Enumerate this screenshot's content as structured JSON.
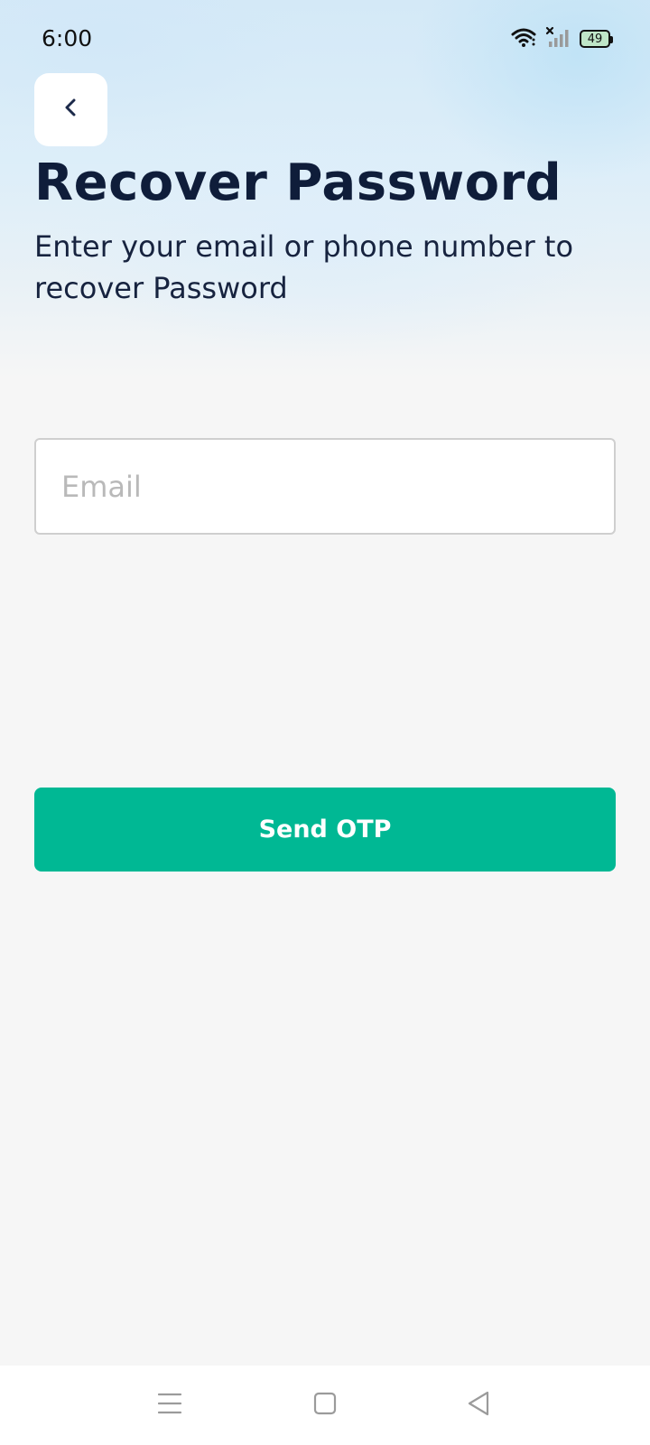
{
  "status_bar": {
    "time": "6:00",
    "battery": "49",
    "icons": [
      "wifi-icon",
      "signal-off-icon",
      "battery-icon"
    ]
  },
  "header": {
    "back_icon": "chevron-left-icon",
    "title": "Recover Password",
    "subtitle": "Enter your email or phone number to recover Password"
  },
  "form": {
    "email_placeholder": "Email",
    "email_value": "",
    "submit_label": "Send OTP"
  },
  "nav_bar": {
    "items": [
      "menu-icon",
      "home-icon",
      "back-triangle-icon"
    ]
  },
  "colors": {
    "accent": "#00b894",
    "title": "#0f1d3a",
    "background": "#f6f6f6"
  }
}
